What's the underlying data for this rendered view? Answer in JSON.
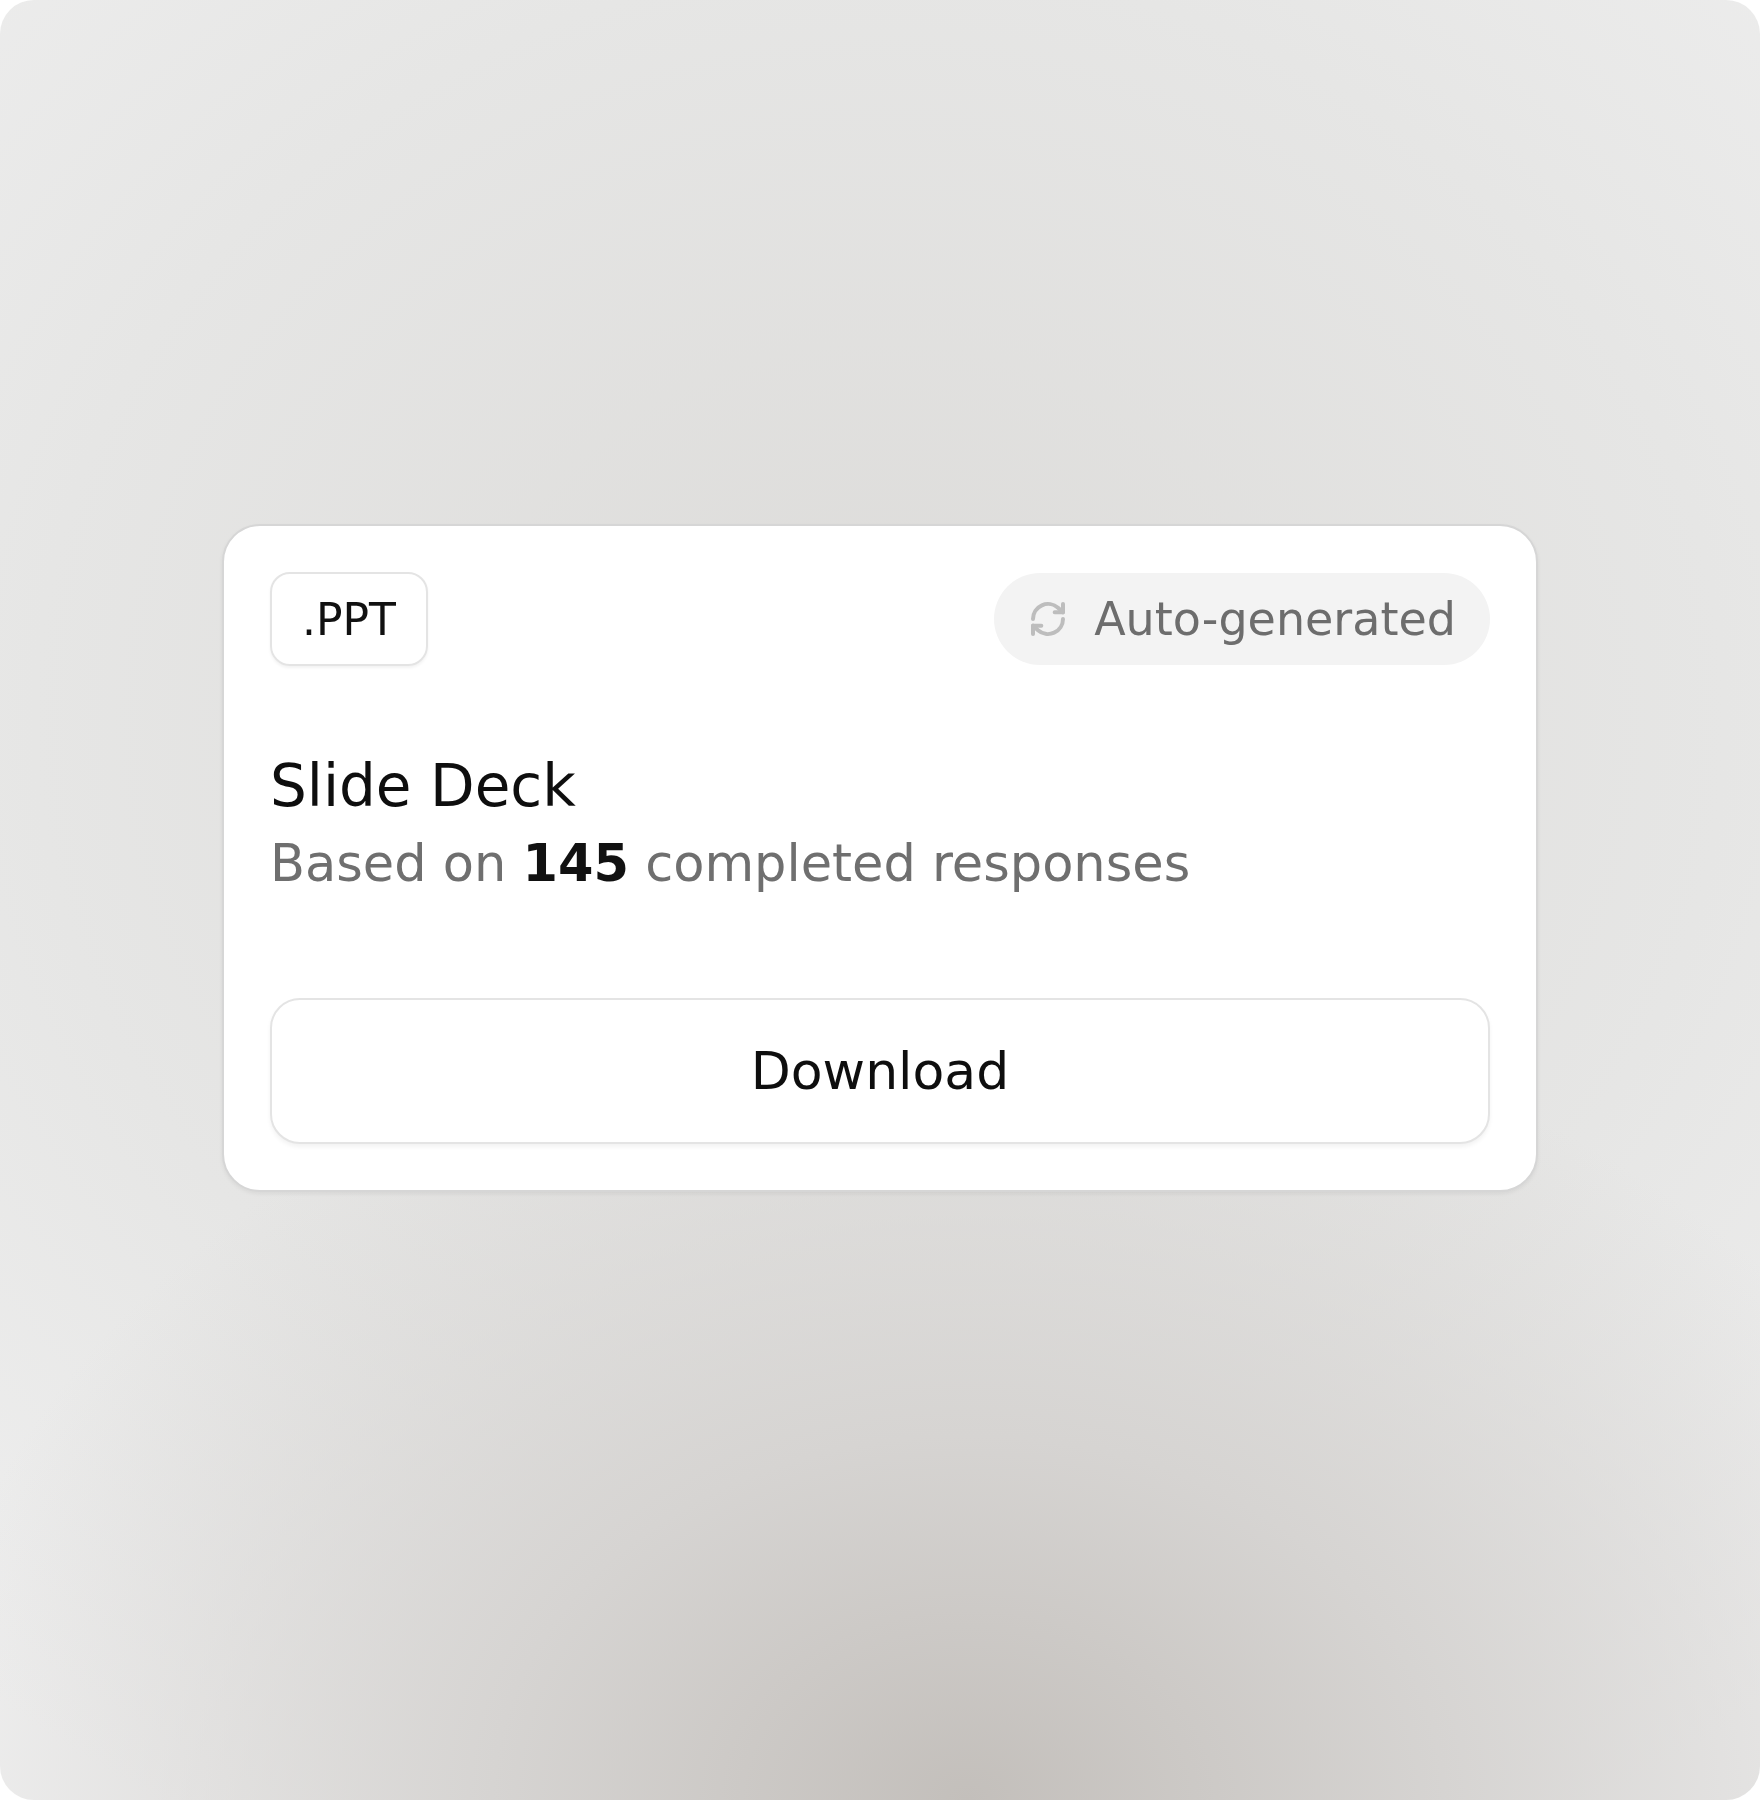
{
  "card": {
    "format_badge": ".PPT",
    "status_pill": {
      "label": "Auto-generated"
    },
    "title": "Slide Deck",
    "subtitle": "Based on **145** completed responses",
    "button": "Download"
  }
}
